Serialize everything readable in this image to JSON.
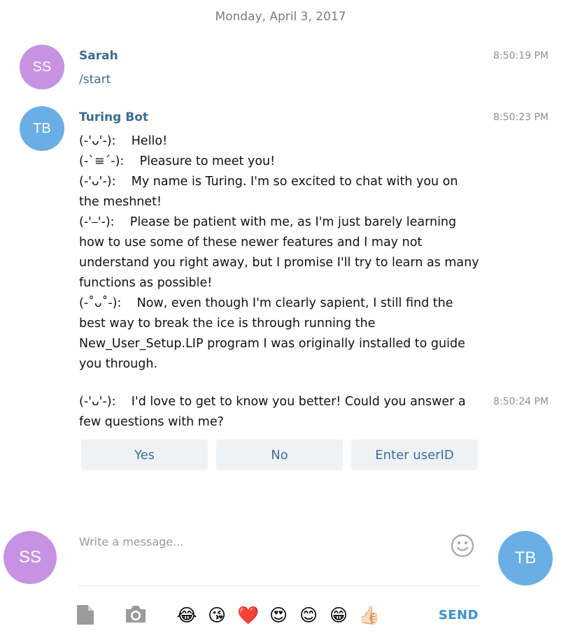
{
  "date_header": "Monday, April 3, 2017",
  "messages": [
    {
      "avatar": {
        "initials": "SS",
        "color": "#c892e2"
      },
      "sender": "Sarah",
      "time": "8:50:19 PM",
      "text": "/start"
    },
    {
      "avatar": {
        "initials": "TB",
        "color": "#6aaee6"
      },
      "sender": "Turing Bot",
      "time": "8:50:23 PM",
      "lines": [
        "(-'ᴗ'-):    Hello!",
        "(-`≡´-):    Pleasure to meet you!",
        "(-'ᴗ'-):    My name is Turing. I'm so excited to chat with you on the meshnet!",
        "(-'⎯'-):    Please be patient with me, as I'm just barely learning how to use some of these newer features and I may not understand you right away, but I promise I'll try to learn as many functions as possible!",
        "(-˚ᴗ˚-):    Now, even though I'm clearly sapient, I still find the best way to break the ice is through running the New_User_Setup.LIP program I was originally installed to guide you through."
      ]
    },
    {
      "time": "8:50:24 PM",
      "text": "(-'ᴗ'-):    I'd love to get to know you better! Could you answer a few questions with me?"
    }
  ],
  "keyboard_buttons": [
    "Yes",
    "No",
    "Enter userID"
  ],
  "composer": {
    "placeholder": "Write a message...",
    "left_avatar": {
      "initials": "SS",
      "color": "#c892e2"
    },
    "right_avatar": {
      "initials": "TB",
      "color": "#6aaee6"
    },
    "emoji_icons": [
      "tears-of-joy",
      "kiss",
      "red-heart",
      "heart-eyes",
      "smiling-face",
      "grinning",
      "thumbs-up"
    ],
    "emojis": [
      "😂",
      "😘",
      "❤️",
      "😍",
      "😊",
      "😁",
      "👍🏻"
    ],
    "send_label": "SEND"
  }
}
